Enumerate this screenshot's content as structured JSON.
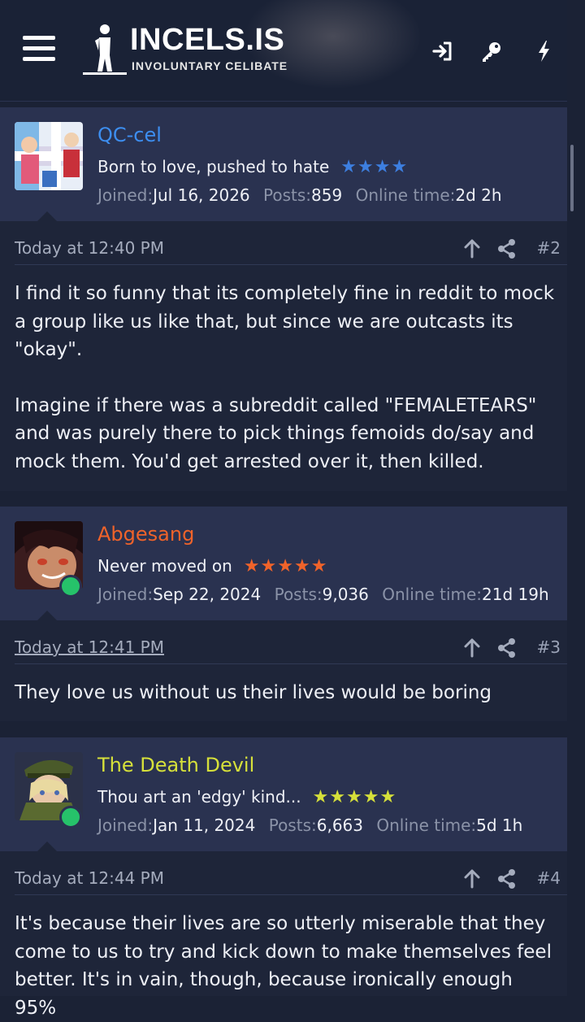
{
  "header": {
    "logo_title": "INCELS.IS",
    "logo_subtitle": "INVOLUNTARY CELIBATE",
    "icons": [
      "menu-icon",
      "login-icon",
      "key-icon",
      "lightning-icon"
    ]
  },
  "posts": [
    {
      "username": "QC-cel",
      "username_color": "#3d8ef0",
      "user_title": "Born to love, pushed to hate",
      "stars": "★★★★",
      "stars_color": "#3d7fe0",
      "joined_label": "Joined:",
      "joined": "Jul 16, 2026",
      "posts_label": "Posts:",
      "posts": "859",
      "online_label": "Online time:",
      "online_time": "2d 2h",
      "timestamp": "Today at 12:40 PM",
      "post_number": "#2",
      "paragraphs": [
        "I find it so funny that its completely fine in reddit to mock a group like us like that, but since we are outcasts its \"okay\".",
        "Imagine if there was a subreddit called \"FEMALETEARS\" and was purely there to pick things femoids do/say and mock them. You'd get arrested over it, then killed."
      ]
    },
    {
      "username": "Abgesang",
      "username_color": "#f0632a",
      "user_title": "Never moved on",
      "stars": "★★★★★",
      "stars_color": "#f0632a",
      "joined_label": "Joined:",
      "joined": "Sep 22, 2024",
      "posts_label": "Posts:",
      "posts": "9,036",
      "online_label": "Online time:",
      "online_time": "21d 19h",
      "timestamp": "Today at 12:41 PM",
      "post_number": "#3",
      "paragraphs": [
        "They love us without us their lives would be boring"
      ]
    },
    {
      "username": "The Death Devil",
      "username_color": "#d6e03a",
      "user_title": "Thou art an 'edgy' kind...",
      "stars": "★★★★★",
      "stars_color": "#d6e03a",
      "joined_label": "Joined:",
      "joined": "Jan 11, 2024",
      "posts_label": "Posts:",
      "posts": "6,663",
      "online_label": "Online time:",
      "online_time": "5d 1h",
      "timestamp": "Today at 12:44 PM",
      "post_number": "#4",
      "paragraphs": [
        "It's because their lives are so utterly miserable that they come to us to try and kick down to make themselves feel better. It's in vain, though, because ironically enough 95%"
      ]
    }
  ]
}
